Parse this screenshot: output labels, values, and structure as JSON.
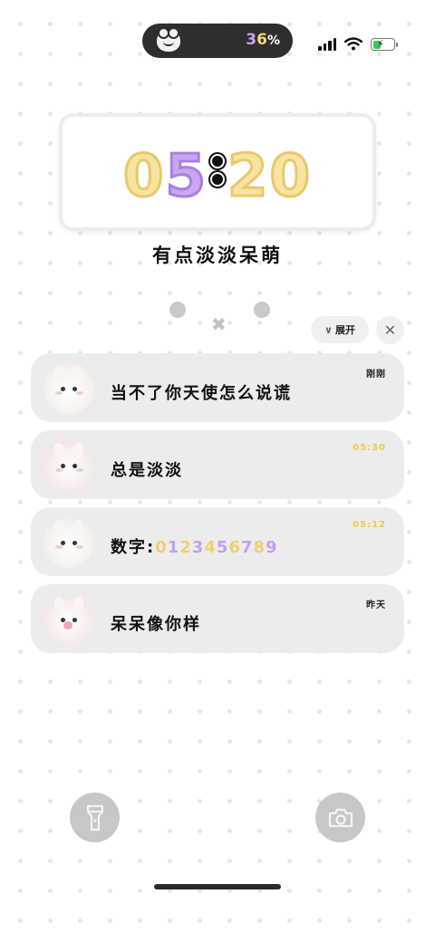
{
  "status_bar": {
    "battery_digits": [
      "3",
      "6"
    ],
    "battery_percent_sign": "%",
    "signal_bars": 4,
    "charging": true
  },
  "clock": {
    "hours": [
      "0",
      "5"
    ],
    "minutes": [
      "2",
      "0"
    ]
  },
  "motto": "有点淡淡呆萌",
  "notification_controls": {
    "expand_label": "展开",
    "expand_icon": "chevron-down-icon",
    "close_icon": "close-icon"
  },
  "notifications": [
    {
      "message": "当不了你天使怎么说谎",
      "time": "刚刚"
    },
    {
      "message": "总是淡淡",
      "time": "05:30"
    },
    {
      "message_prefix": "数字:",
      "message_digits": "0123456789",
      "time": "05:12"
    },
    {
      "message": "呆呆像你样",
      "time": "昨天"
    }
  ],
  "quick_actions": {
    "left_icon": "flashlight-icon",
    "right_icon": "camera-icon"
  },
  "colors": {
    "yellow_digit": "#f7e3a2",
    "purple_digit": "#c9a6f2",
    "notification_bg": "#ececec"
  }
}
